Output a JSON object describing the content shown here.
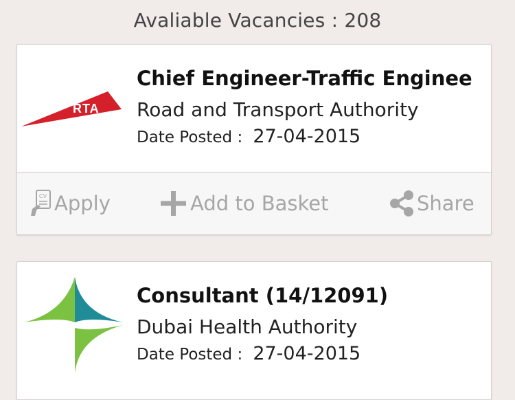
{
  "header": {
    "text": "Avaliable Vacancies : 208"
  },
  "jobs": [
    {
      "title": "Chief Engineer-Traffic Enginee",
      "organization": "Road and Transport Authority",
      "date_label": "Date Posted :",
      "date_value": "27-04-2015",
      "logo_text": "RTA",
      "logo_icon": "rta-logo",
      "actions": {
        "apply_label": "Apply",
        "apply_icon_text": "CV",
        "basket_label": "Add to Basket",
        "share_label": "Share"
      }
    },
    {
      "title": "Consultant (14/12091)",
      "organization": "Dubai Health Authority",
      "date_label": "Date Posted :",
      "date_value": "27-04-2015",
      "logo_icon": "dha-logo"
    }
  ],
  "colors": {
    "background": "#f1ebe9",
    "rta_red": "#d4202a",
    "dha_teal": "#1f8c98",
    "dha_green": "#7cc242",
    "action_gray": "#a6a6a6"
  }
}
